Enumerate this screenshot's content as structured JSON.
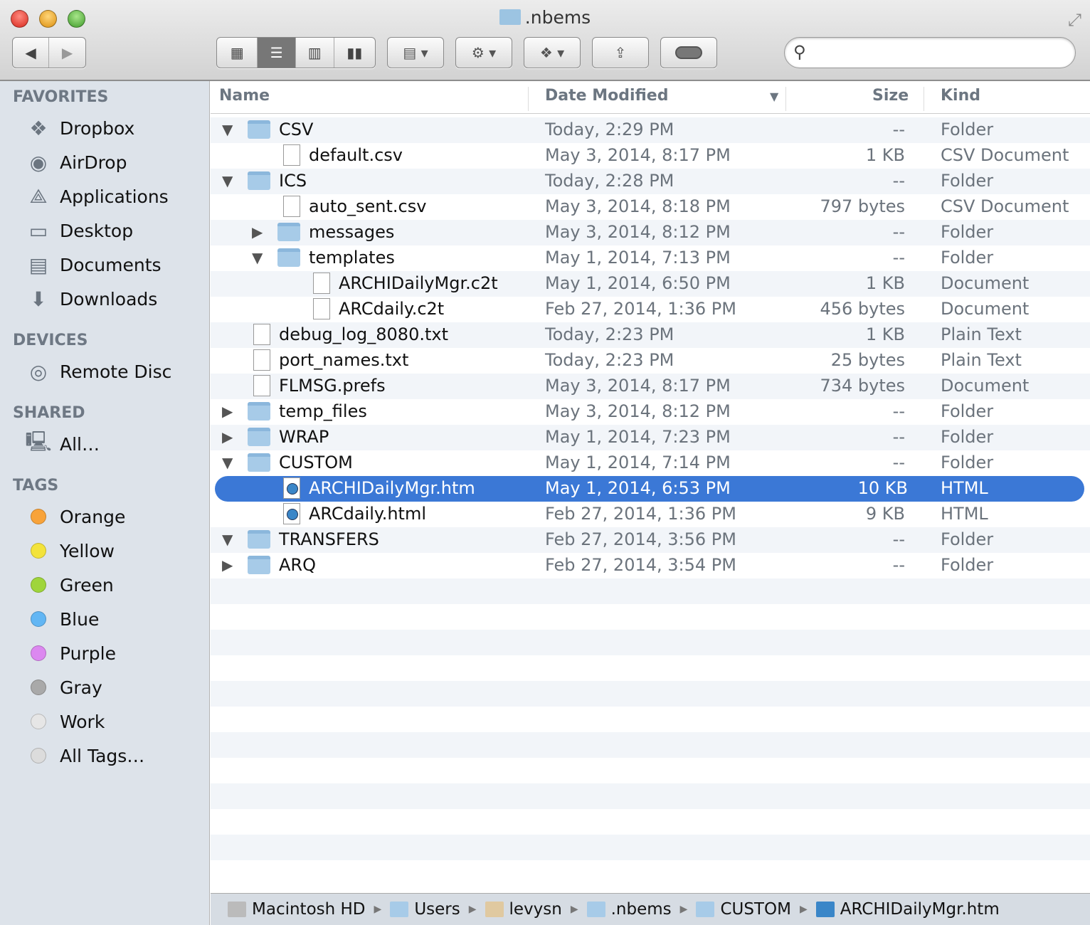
{
  "window": {
    "title": ".nbems"
  },
  "toolbar": {
    "back": "◀",
    "forward": "▶",
    "search_placeholder": ""
  },
  "sidebar": {
    "favorites_label": "FAVORITES",
    "devices_label": "DEVICES",
    "shared_label": "SHARED",
    "tags_label": "TAGS",
    "favorites": [
      {
        "label": "Dropbox",
        "icon": "dropbox-icon"
      },
      {
        "label": "AirDrop",
        "icon": "airdrop-icon"
      },
      {
        "label": "Applications",
        "icon": "applications-icon"
      },
      {
        "label": "Desktop",
        "icon": "desktop-icon"
      },
      {
        "label": "Documents",
        "icon": "documents-icon"
      },
      {
        "label": "Downloads",
        "icon": "downloads-icon"
      }
    ],
    "devices": [
      {
        "label": "Remote Disc"
      }
    ],
    "shared": [
      {
        "label": "All…"
      }
    ],
    "tags": [
      {
        "label": "Orange",
        "color": "#f8a33a"
      },
      {
        "label": "Yellow",
        "color": "#f3e33b"
      },
      {
        "label": "Green",
        "color": "#9fd53b"
      },
      {
        "label": "Blue",
        "color": "#62b6f4"
      },
      {
        "label": "Purple",
        "color": "#dc88f0"
      },
      {
        "label": "Gray",
        "color": "#a9a9a9"
      },
      {
        "label": "Work",
        "color": "#e6e6e6"
      },
      {
        "label": "All Tags…",
        "color": "#dcdcdc"
      }
    ]
  },
  "columns": {
    "name": "Name",
    "date": "Date Modified",
    "size": "Size",
    "kind": "Kind"
  },
  "files": [
    {
      "name": "CSV",
      "date": "Today, 2:29 PM",
      "size": "--",
      "kind": "Folder",
      "level": 0,
      "type": "folder",
      "disclosure": "open"
    },
    {
      "name": "default.csv",
      "date": "May 3, 2014, 8:17 PM",
      "size": "1 KB",
      "kind": "CSV Document",
      "level": 1,
      "type": "doc"
    },
    {
      "name": "ICS",
      "date": "Today, 2:28 PM",
      "size": "--",
      "kind": "Folder",
      "level": 0,
      "type": "folder",
      "disclosure": "open"
    },
    {
      "name": "auto_sent.csv",
      "date": "May 3, 2014, 8:18 PM",
      "size": "797 bytes",
      "kind": "CSV Document",
      "level": 1,
      "type": "doc"
    },
    {
      "name": "messages",
      "date": "May 3, 2014, 8:12 PM",
      "size": "--",
      "kind": "Folder",
      "level": 1,
      "type": "folder",
      "disclosure": "closed"
    },
    {
      "name": "templates",
      "date": "May 1, 2014, 7:13 PM",
      "size": "--",
      "kind": "Folder",
      "level": 1,
      "type": "folder",
      "disclosure": "open"
    },
    {
      "name": "ARCHIDailyMgr.c2t",
      "date": "May 1, 2014, 6:50 PM",
      "size": "1 KB",
      "kind": "Document",
      "level": 2,
      "type": "doc"
    },
    {
      "name": "ARCdaily.c2t",
      "date": "Feb 27, 2014, 1:36 PM",
      "size": "456 bytes",
      "kind": "Document",
      "level": 2,
      "type": "doc"
    },
    {
      "name": "debug_log_8080.txt",
      "date": "Today, 2:23 PM",
      "size": "1 KB",
      "kind": "Plain Text",
      "level": 0,
      "type": "doc"
    },
    {
      "name": "port_names.txt",
      "date": "Today, 2:23 PM",
      "size": "25 bytes",
      "kind": "Plain Text",
      "level": 0,
      "type": "doc"
    },
    {
      "name": "FLMSG.prefs",
      "date": "May 3, 2014, 8:17 PM",
      "size": "734 bytes",
      "kind": "Document",
      "level": 0,
      "type": "doc"
    },
    {
      "name": "temp_files",
      "date": "May 3, 2014, 8:12 PM",
      "size": "--",
      "kind": "Folder",
      "level": 0,
      "type": "folder",
      "disclosure": "closed"
    },
    {
      "name": "WRAP",
      "date": "May 1, 2014, 7:23 PM",
      "size": "--",
      "kind": "Folder",
      "level": 0,
      "type": "folder",
      "disclosure": "closed"
    },
    {
      "name": "CUSTOM",
      "date": "May 1, 2014, 7:14 PM",
      "size": "--",
      "kind": "Folder",
      "level": 0,
      "type": "folder",
      "disclosure": "open"
    },
    {
      "name": "ARCHIDailyMgr.htm",
      "date": "May 1, 2014, 6:53 PM",
      "size": "10 KB",
      "kind": "HTML",
      "level": 1,
      "type": "html",
      "selected": true
    },
    {
      "name": "ARCdaily.html",
      "date": "Feb 27, 2014, 1:36 PM",
      "size": "9 KB",
      "kind": "HTML",
      "level": 1,
      "type": "html"
    },
    {
      "name": "TRANSFERS",
      "date": "Feb 27, 2014, 3:56 PM",
      "size": "--",
      "kind": "Folder",
      "level": 0,
      "type": "folder",
      "disclosure": "open"
    },
    {
      "name": "ARQ",
      "date": "Feb 27, 2014, 3:54 PM",
      "size": "--",
      "kind": "Folder",
      "level": 0,
      "type": "folder",
      "disclosure": "closed"
    }
  ],
  "pathbar": [
    {
      "label": "Macintosh HD",
      "icon": "hard-drive-icon",
      "color": "#bbb"
    },
    {
      "label": "Users",
      "icon": "users-folder-icon",
      "color": "#a7cbe8"
    },
    {
      "label": "levysn",
      "icon": "home-icon",
      "color": "#e0c9a0"
    },
    {
      "label": ".nbems",
      "icon": "folder-icon",
      "color": "#a7cbe8"
    },
    {
      "label": "CUSTOM",
      "icon": "folder-icon",
      "color": "#a7cbe8"
    },
    {
      "label": "ARCHIDailyMgr.htm",
      "icon": "html-file-icon",
      "color": "#3a86c8"
    }
  ]
}
